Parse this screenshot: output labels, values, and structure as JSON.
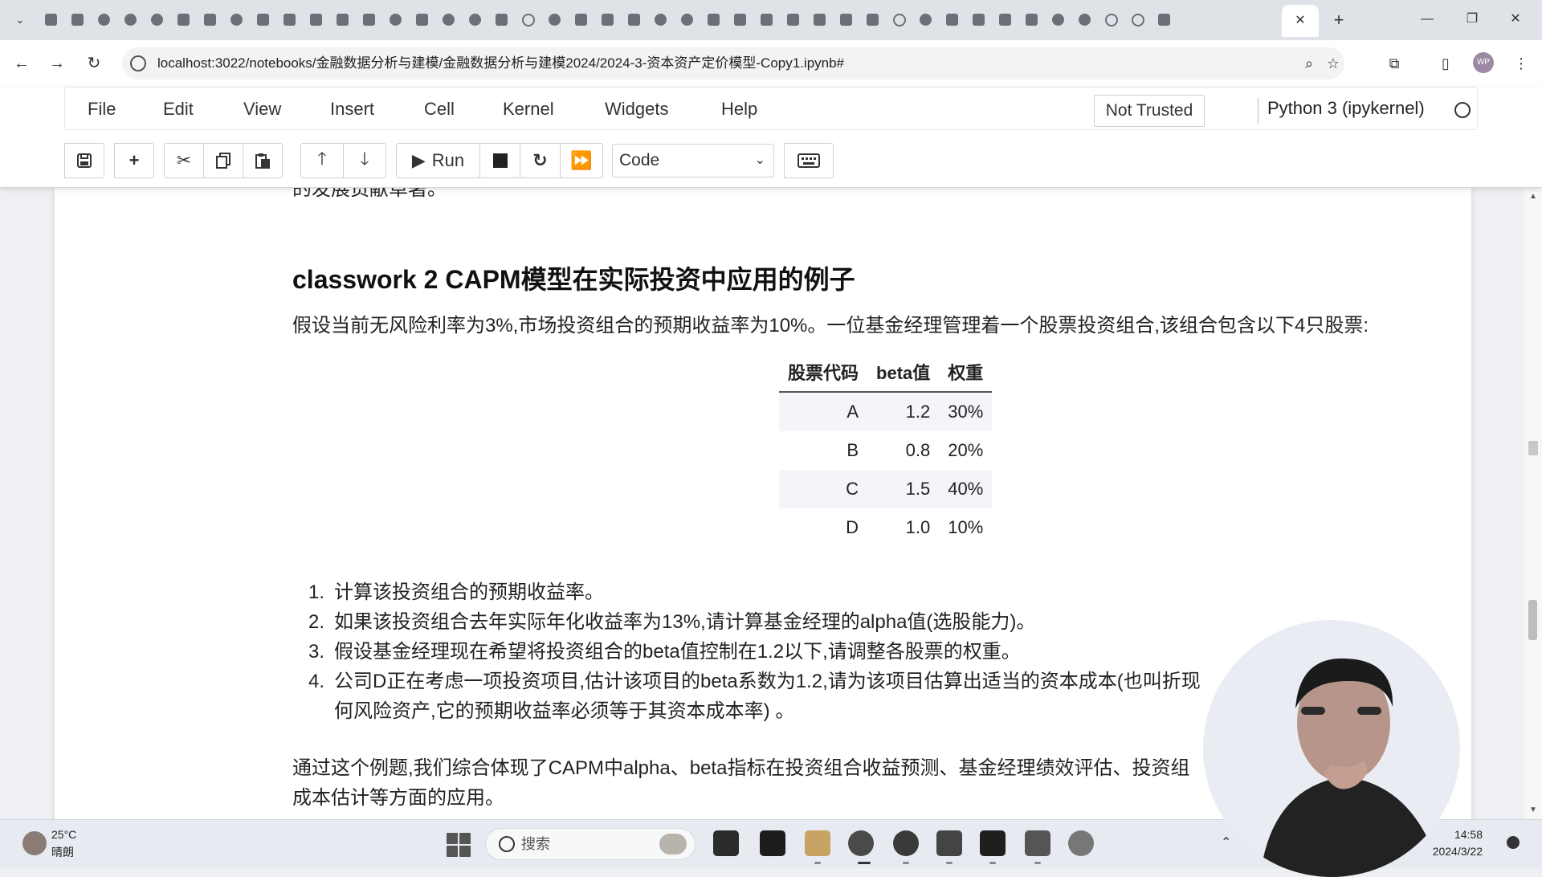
{
  "browser": {
    "active_tab_close": "✕",
    "new_tab": "+",
    "window_minimize": "—",
    "window_restore": "❐",
    "window_close": "✕",
    "url": "localhost:3022/notebooks/金融数据分析与建模/金融数据分析与建模2024/2024-3-资本资产定价模型-Copy1.ipynb#",
    "avatar_initials": "WP"
  },
  "jupyter": {
    "menu": [
      "File",
      "Edit",
      "View",
      "Insert",
      "Cell",
      "Kernel",
      "Widgets",
      "Help"
    ],
    "trust_status": "Not Trusted",
    "kernel_name": "Python 3 (ipykernel)",
    "run_label": "Run",
    "cell_type": "Code"
  },
  "notebook": {
    "cut_text": "的发展贡献卓著。",
    "heading": "classwork 2 CAPM模型在实际投资中应用的例子",
    "intro": "假设当前无风险利率为3%,市场投资组合的预期收益率为10%。一位基金经理管理着一个股票投资组合,该组合包含以下4只股票:",
    "table": {
      "headers": [
        "股票代码",
        "beta值",
        "权重"
      ],
      "rows": [
        [
          "A",
          "1.2",
          "30%"
        ],
        [
          "B",
          "0.8",
          "20%"
        ],
        [
          "C",
          "1.5",
          "40%"
        ],
        [
          "D",
          "1.0",
          "10%"
        ]
      ]
    },
    "questions": [
      {
        "num": "1.",
        "text": "计算该投资组合的预期收益率。"
      },
      {
        "num": "2.",
        "text": "如果该投资组合去年实际年化收益率为13%,请计算基金经理的alpha值(选股能力)。"
      },
      {
        "num": "3.",
        "text": "假设基金经理现在希望将投资组合的beta值控制在1.2以下,请调整各股票的权重。"
      },
      {
        "num": "4.",
        "text": "公司D正在考虑一项投资项目,估计该项目的beta系数为1.2,请为该项目估算出适当的资本成本(也叫折现",
        "text2": "何风险资产,它的预期收益率必须等于其资本成本率)   。"
      }
    ],
    "conclusion_1": "通过这个例题,我们综合体现了CAPM中alpha、beta指标在投资组合收益预测、基金经理绩效评估、投资组",
    "conclusion_2": "成本估计等方面的应用。"
  },
  "taskbar": {
    "weather_temp": "25°C",
    "weather_cond": "晴朗",
    "search_placeholder": "搜索",
    "time": "14:58",
    "date": "2024/3/22"
  }
}
